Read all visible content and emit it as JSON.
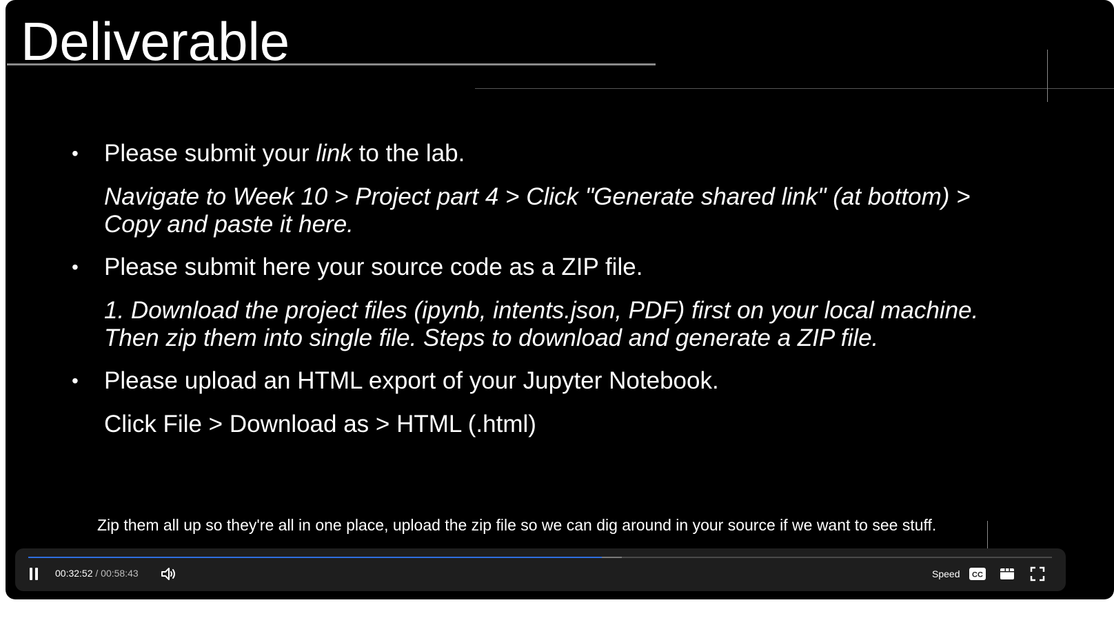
{
  "slide": {
    "title": "Deliverable",
    "bullets": [
      {
        "lead": "Please submit your ",
        "emphasis": "link",
        "tail": " to the lab.",
        "detail": "Navigate to Week 10 > Project part 4 > Click \"Generate shared link\" (at bottom) > Copy and paste it here."
      },
      {
        "text": "Please submit here your source code as a ZIP file.",
        "detail": "1. Download the project files (ipynb, intents.json, PDF) first on your local machine. Then zip them into single file. Steps to download and generate a ZIP file."
      },
      {
        "text": "Please upload an HTML export of your Jupyter Notebook.",
        "detail": "Click File > Download as > HTML (.html)"
      }
    ]
  },
  "caption": "Zip them all up so they're all in one place, upload the zip file so we can dig around in your source if we want to see stuff.",
  "player": {
    "current_time": "00:32:52",
    "separator": "/",
    "duration": "00:58:43",
    "progress_fraction": 0.56,
    "buffered_fraction": 0.58,
    "speed_label": "Speed",
    "icons": {
      "play_pause": "pause-icon",
      "volume": "volume-icon",
      "captions": "closed-captions-icon",
      "layout": "layout-icon",
      "fullscreen": "fullscreen-icon"
    },
    "colors": {
      "progress": "#2f6fe0",
      "bar_background": "#1e1e1e"
    }
  }
}
